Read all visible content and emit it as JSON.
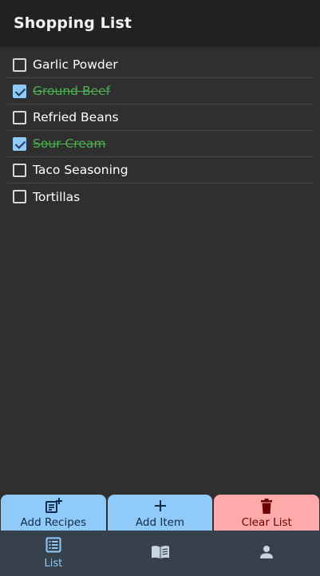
{
  "header": {
    "title": "Shopping List"
  },
  "items": [
    {
      "label": "Garlic Powder",
      "checked": false
    },
    {
      "label": "Ground Beef",
      "checked": true
    },
    {
      "label": "Refried Beans",
      "checked": false
    },
    {
      "label": "Sour Cream",
      "checked": true
    },
    {
      "label": "Taco Seasoning",
      "checked": false
    },
    {
      "label": "Tortillas",
      "checked": false
    }
  ],
  "actions": {
    "add_recipes": "Add Recipes",
    "add_item": "Add Item",
    "clear_list": "Clear List"
  },
  "nav": {
    "list_label": "List",
    "icons": [
      "list-icon",
      "book-icon",
      "person-icon"
    ]
  },
  "colors": {
    "background": "#2f2f2f",
    "header": "#212121",
    "checked_text": "#4caf50",
    "accent_blue": "#90caf9",
    "accent_red": "#ffaaaa",
    "nav": "#37414d"
  }
}
